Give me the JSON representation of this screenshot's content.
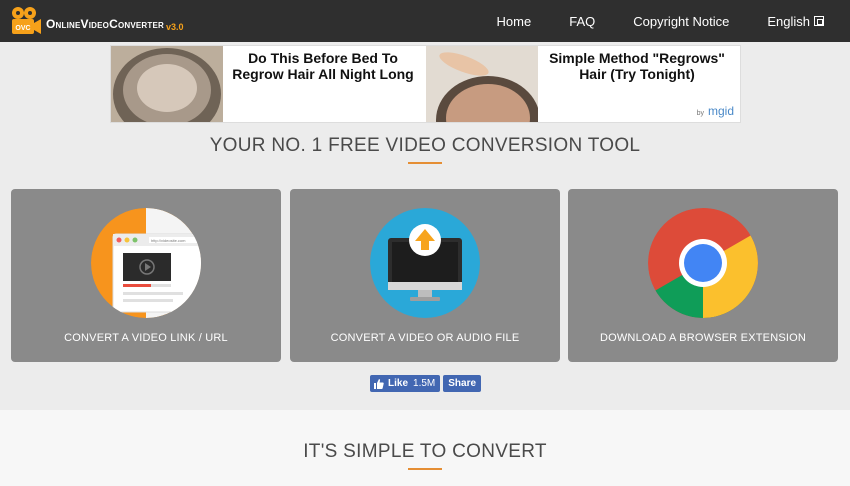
{
  "nav": {
    "logo_text": "OnlineVideoConverter",
    "logo_version": "v3.0",
    "logo_badge": "OVC",
    "links": [
      "Home",
      "FAQ",
      "Copyright Notice",
      "English"
    ]
  },
  "ad": {
    "headline1": "Do This Before Bed To Regrow Hair All Night Long",
    "headline2": "Simple Method \"Regrows\" Hair (Try Tonight)",
    "by": "by",
    "brand": "mgid"
  },
  "main": {
    "title": "YOUR NO. 1 FREE VIDEO CONVERSION TOOL",
    "cards": [
      {
        "label": "CONVERT A VIDEO LINK / URL",
        "icon": "video-link-icon",
        "url_text": "http://videosite.com"
      },
      {
        "label": "CONVERT A VIDEO OR AUDIO FILE",
        "icon": "upload-monitor-icon"
      },
      {
        "label": "DOWNLOAD A BROWSER EXTENSION",
        "icon": "chrome-icon"
      }
    ]
  },
  "social": {
    "like_label": "Like",
    "like_count": "1.5M",
    "share_label": "Share"
  },
  "lower": {
    "title": "IT'S SIMPLE TO CONVERT"
  },
  "colors": {
    "nav_bg": "#2f2f2f",
    "accent": "#e58e34",
    "card_bg": "#8a8a8a",
    "facebook": "#4267b2"
  }
}
